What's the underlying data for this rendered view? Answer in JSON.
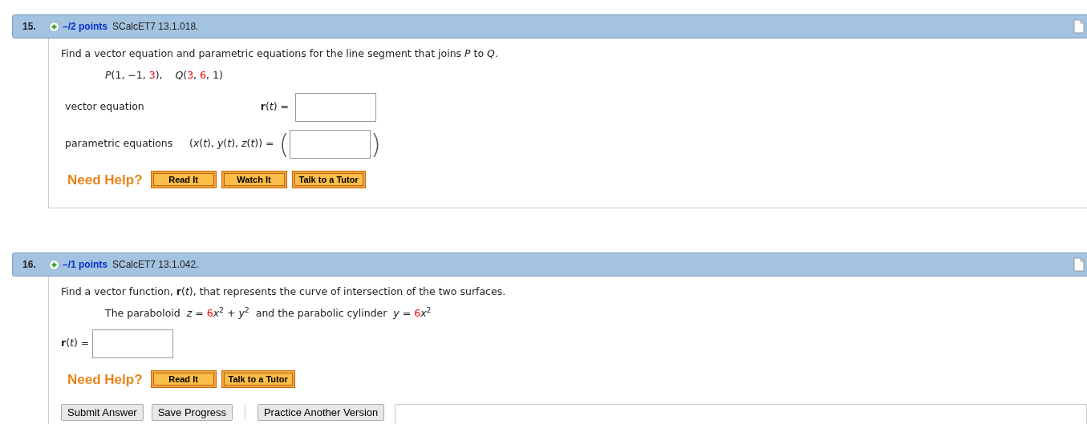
{
  "questions": [
    {
      "number": "15.",
      "points": "–/2 points",
      "code": "SCalcET7 13.1.018.",
      "prompt": "Find a vector equation and parametric equations for the line segment that joins *P* to *Q*.",
      "given": [
        {
          "kind": "plain",
          "text": "*P*(1, −1, "
        },
        {
          "kind": "value",
          "text": "3"
        },
        {
          "kind": "plain",
          "text": "),    *Q*("
        },
        {
          "kind": "value",
          "text": "3"
        },
        {
          "kind": "plain",
          "text": ", "
        },
        {
          "kind": "value",
          "text": "6"
        },
        {
          "kind": "plain",
          "text": ", 1)"
        }
      ],
      "answers": [
        {
          "kind": "labeled",
          "label": "vector equation",
          "expr": "**r**(*t*) ="
        },
        {
          "kind": "labeled",
          "label": "parametric equations",
          "expr": "(*x*(*t*), *y*(*t*), *z*(*t*)) =",
          "open": "(",
          "close": ")"
        }
      ],
      "help_label": "Need Help?",
      "help_buttons": [
        "Read It",
        "Watch It",
        "Talk to a Tutor"
      ]
    },
    {
      "number": "16.",
      "points": "–/1 points",
      "code": "SCalcET7 13.1.042.",
      "prompt": "Find a vector function, **r**(*t*), that represents the curve of intersection of the two surfaces.",
      "given": [
        {
          "kind": "plain",
          "text": "The paraboloid  *z* = "
        },
        {
          "kind": "value",
          "text": "6"
        },
        {
          "kind": "plain",
          "text": "*x*$^{2}$ + *y*$^{2}$  and the parabolic cylinder  *y* = "
        },
        {
          "kind": "value",
          "text": "6"
        },
        {
          "kind": "plain",
          "text": "*x*$^{2}$"
        }
      ],
      "answers": [
        {
          "kind": "inline",
          "expr": "**r**(*t*) ="
        }
      ],
      "help_label": "Need Help?",
      "help_buttons": [
        "Read It",
        "Talk to a Tutor"
      ],
      "footer_buttons": [
        "Submit Answer",
        "Save Progress",
        "Practice Another Version"
      ]
    }
  ]
}
